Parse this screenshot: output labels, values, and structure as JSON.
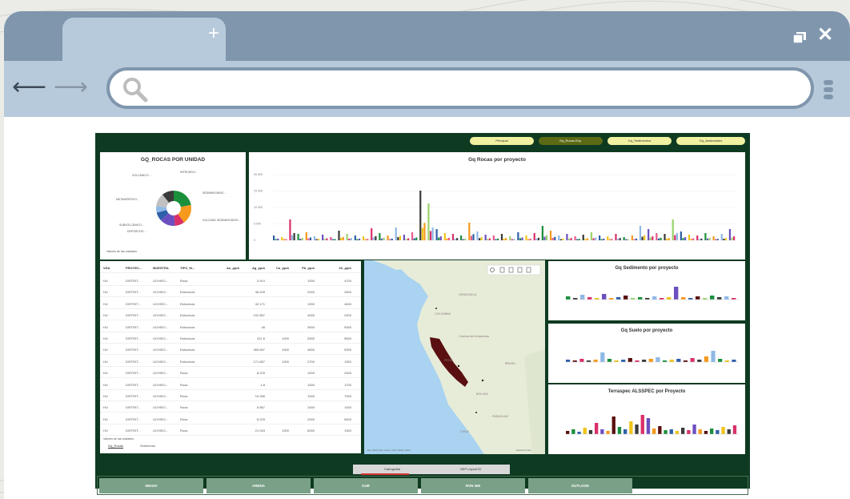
{
  "browser": {
    "new_tab_label": "+",
    "url_value": "",
    "url_placeholder": ""
  },
  "dashboard": {
    "nav": [
      {
        "label": "Principal",
        "active": false
      },
      {
        "label": "Gq_Rocas Exp.",
        "active": true
      },
      {
        "label": "Gq_Sedimentos",
        "active": false
      },
      {
        "label": "Gq_Aestranstes",
        "active": false
      }
    ],
    "pie": {
      "title": "GQ_ROCAS POR UNIDAD",
      "footnote": "Valores de las unidades",
      "labels": [
        "INTRUSIVO…",
        "VOLCÁNICO…",
        "SEDIMENTARIO…",
        "METAMÓRFICO…",
        "VOLCANO SEDIMENTARIO…",
        "SUBVOLCÁNICO…",
        "DEPÓSITOS…"
      ],
      "values": [
        22,
        18,
        9,
        14,
        8,
        6,
        12,
        11
      ],
      "colors": [
        "#1a8f3c",
        "#f59a1c",
        "#d9306a",
        "#6b4fbf",
        "#2f5fa8",
        "#8fb9e6",
        "#c0c0c0",
        "#3a3a3a"
      ]
    },
    "bar_main": {
      "title": "Gq Rocas por proyecto",
      "y_ticks": [
        "20 000",
        "15 000",
        "10 000",
        "5 000",
        "0"
      ]
    },
    "table": {
      "columns": [
        "VDA",
        "PROYEC...",
        "MUESTRA",
        "TIPO_M...",
        "Au_ppm",
        "Ag_ppm",
        "Cu_ppm",
        "Pb_ppm",
        "Zn_ppm"
      ],
      "rows": [
        [
          "HU",
          "DISTRIT...",
          "UCHISO...",
          "Roca",
          "",
          "3.914",
          "",
          "1000",
          "4700"
        ],
        [
          "HU",
          "DISTRIT...",
          "UCHISO...",
          "Estructura",
          "",
          "48.209",
          "",
          "2000",
          "2600"
        ],
        [
          "HU",
          "DISTRIT...",
          "UCHISO...",
          "Estructura",
          "",
          "42.171",
          "",
          "1000",
          "4400"
        ],
        [
          "HU",
          "DISTRIT...",
          "UCHISO...",
          "Estructura",
          "",
          "102.857",
          "",
          "4000",
          "2400"
        ],
        [
          "HU",
          "DISTRIT...",
          "UCHISO...",
          "Estructura",
          "",
          "48",
          "",
          "3000",
          "5300"
        ],
        [
          "HU",
          "DISTRIT...",
          "UCHISO...",
          "Estructura",
          "",
          "421.6",
          "1000",
          "5300",
          "5500"
        ],
        [
          "HU",
          "DISTRIT...",
          "UCHISO...",
          "Estructura",
          "",
          "365.657",
          "1000",
          "4600",
          "5300"
        ],
        [
          "HU",
          "DISTRIT...",
          "UCHISO...",
          "Estructura",
          "",
          "171.657",
          "1000",
          "2700",
          "1300"
        ],
        [
          "HU",
          "DISTRIT...",
          "UCHISO...",
          "Roca",
          "",
          "8.229",
          "",
          "1000",
          "2400"
        ],
        [
          "HU",
          "DISTRIT...",
          "UCHISO...",
          "Roca",
          "",
          "1.8",
          "",
          "1000",
          "1700"
        ],
        [
          "HU",
          "DISTRIT...",
          "UCHISO...",
          "Roca",
          "",
          "10.286",
          "",
          "1000",
          "7000"
        ],
        [
          "HU",
          "DISTRIT...",
          "UCHISO...",
          "Roca",
          "",
          "6.857",
          "",
          "1000",
          "1400"
        ],
        [
          "HU",
          "DISTRIT...",
          "UCHISO...",
          "Roca",
          "",
          "8.229",
          "",
          "2000",
          "5400"
        ],
        [
          "HU",
          "DISTRIT...",
          "UCHISO...",
          "Roca",
          "",
          "21.943",
          "1000",
          "8000",
          "1300"
        ]
      ],
      "footnote": "Valores de las unidades",
      "tabs": [
        "Gq_Rocas",
        "Sedimento"
      ]
    },
    "map": {
      "labels": [
        "VENEZUELA",
        "COLOMBIA",
        "Cuenca del Amazonas",
        "BRASIL",
        "PERÚ",
        "BOLIVIA",
        "PARAGUAY",
        "CHILE"
      ],
      "attribution": "Esri, USGS | Esri, Garmin, FAO, NOAA, USGS",
      "powered": "Powered by Esri"
    },
    "bar_sed": {
      "title": "Gq Sedimento por proyecto"
    },
    "bar_suelo": {
      "title": "Gq Suelo por proyecto"
    },
    "bar_terra": {
      "title": "Terraspec ALSSPEC por Proyecto"
    },
    "bottom_tabs": [
      "Cartografía",
      "GEP Layout ID"
    ],
    "buttons": [
      "INGGO",
      "ARENA",
      "CUR",
      "RVN 360",
      "OUTLOOK"
    ]
  }
}
